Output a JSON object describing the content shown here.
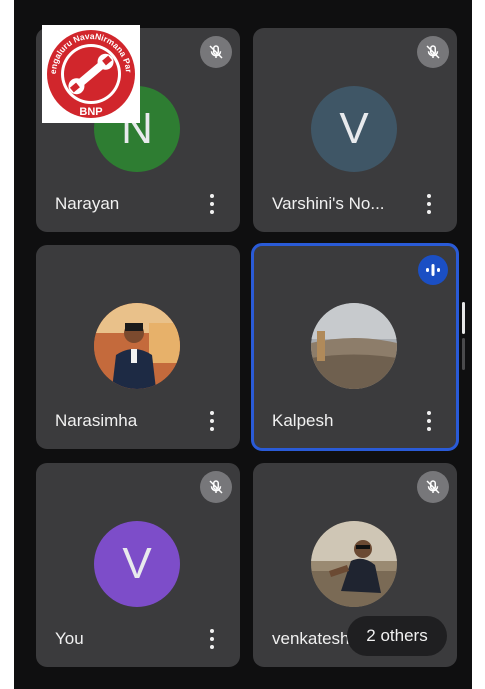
{
  "logo": {
    "text_top": "Bengaluru NavaNirmana Party",
    "text_bottom": "BNP",
    "color": "#d1262c"
  },
  "tiles": [
    {
      "name": "Narayan",
      "initial": "N",
      "avatar_color": "#2e7d32",
      "muted": true,
      "active": false
    },
    {
      "name": "Varshini's No...",
      "initial": "V",
      "avatar_color": "#3f5666",
      "muted": true,
      "active": false
    },
    {
      "name": "Narasimha",
      "initial": "",
      "avatar_type": "photo",
      "muted": false,
      "active": false
    },
    {
      "name": "Kalpesh",
      "initial": "",
      "avatar_type": "photo",
      "muted": false,
      "active": true,
      "speaking": true
    },
    {
      "name": "You",
      "initial": "V",
      "avatar_color": "#7d4dc9",
      "muted": true,
      "active": false
    },
    {
      "name": "venkatesh",
      "initial": "",
      "avatar_type": "photo",
      "muted": true,
      "active": false
    }
  ],
  "overflow": {
    "label": "2 others"
  },
  "colors": {
    "tile_bg": "#3b3b3d",
    "active_border": "#2a5bd7",
    "screen_bg": "#0f0f10"
  },
  "icons": {
    "mute": "mic-off-icon",
    "more": "more-vert-icon",
    "speaking": "audio-wave-icon"
  }
}
